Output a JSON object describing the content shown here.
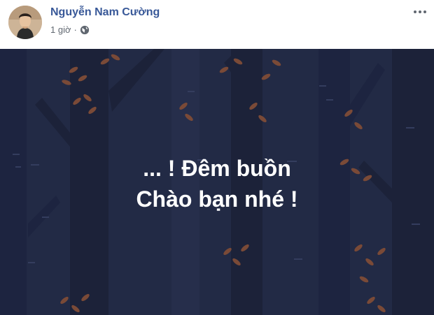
{
  "post": {
    "author_name": "Nguyễn Nam Cường",
    "timestamp": "1 giờ",
    "separator": "·",
    "privacy_icon": "globe-icon",
    "more_icon": "ellipsis-icon",
    "text_lines": [
      "... ! Đêm buồn",
      "Chào bạn nhé !"
    ],
    "background": {
      "theme": "night-forest",
      "base_color": "#222a45",
      "trunk_color": "#1c2239",
      "leaf_color": "#7a4a37",
      "text_color": "#ffffff"
    }
  },
  "colors": {
    "author_link": "#385898",
    "meta_text": "#606770"
  }
}
